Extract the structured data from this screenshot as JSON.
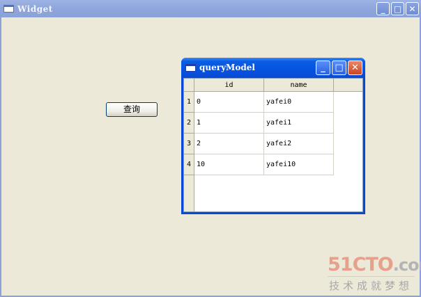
{
  "window": {
    "title": "Widget",
    "controls": {
      "minimize": "_",
      "maximize": "□",
      "close": "✕"
    }
  },
  "query_button": {
    "label": "查询"
  },
  "model_window": {
    "title": "queryModel",
    "controls": {
      "minimize": "_",
      "maximize": "□",
      "close": "✕"
    },
    "table": {
      "columns": [
        "id",
        "name"
      ],
      "rows": [
        {
          "num": "1",
          "id": "0",
          "name": "yafei0"
        },
        {
          "num": "2",
          "id": "1",
          "name": "yafei1"
        },
        {
          "num": "3",
          "id": "2",
          "name": "yafei2"
        },
        {
          "num": "4",
          "id": "10",
          "name": "yafei10"
        }
      ]
    }
  },
  "watermark": {
    "logo": "51CTO",
    "logo_suffix": ".com",
    "tagline": "技术成就梦想"
  }
}
